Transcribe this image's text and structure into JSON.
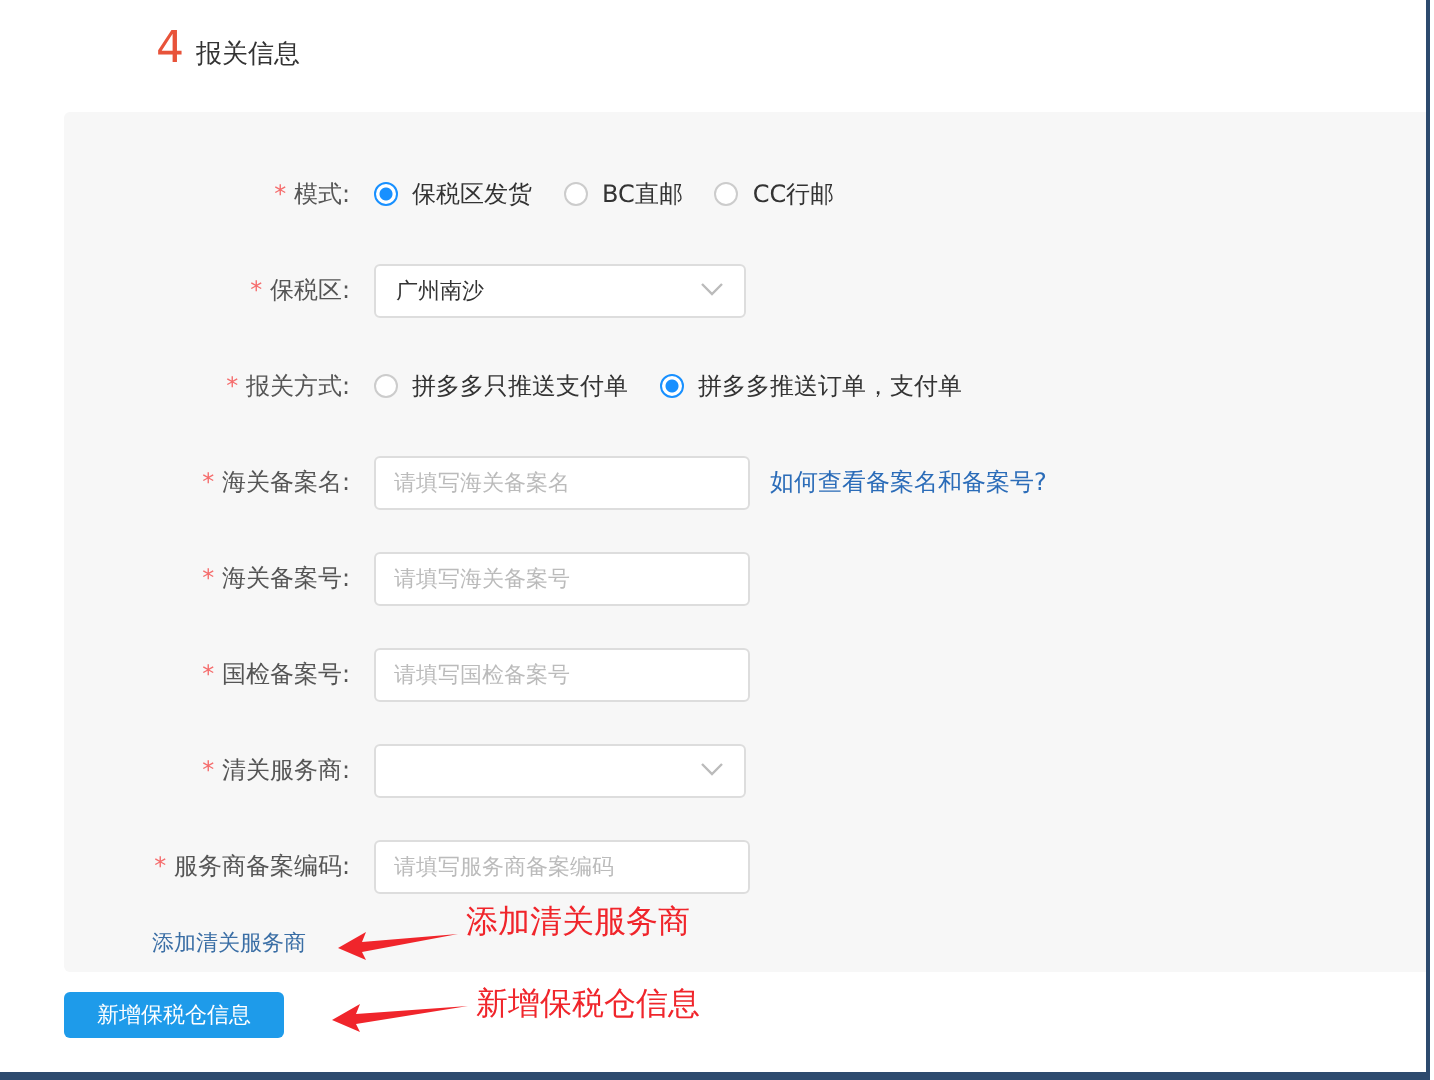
{
  "section": {
    "number": "4",
    "title": "报关信息"
  },
  "rows": [
    {
      "kind": "radio",
      "required_mark": "*",
      "label": "模式:",
      "options": [
        {
          "label": "保税区发货",
          "selected": true
        },
        {
          "label": "BC直邮",
          "selected": false
        },
        {
          "label": "CC行邮",
          "selected": false
        }
      ]
    },
    {
      "kind": "select",
      "required_mark": "*",
      "label": "保税区:",
      "value": "广州南沙"
    },
    {
      "kind": "radio",
      "required_mark": "*",
      "label": "报关方式:",
      "options": [
        {
          "label": "拼多多只推送支付单",
          "selected": false
        },
        {
          "label": "拼多多推送订单，支付单",
          "selected": true
        }
      ]
    },
    {
      "kind": "input",
      "required_mark": "*",
      "label": "海关备案名:",
      "placeholder": "请填写海关备案名",
      "link": "如何查看备案名和备案号?"
    },
    {
      "kind": "input",
      "required_mark": "*",
      "label": "海关备案号:",
      "placeholder": "请填写海关备案号"
    },
    {
      "kind": "input",
      "required_mark": "*",
      "label": "国检备案号:",
      "placeholder": "请填写国检备案号"
    },
    {
      "kind": "select",
      "required_mark": "*",
      "label": "清关服务商:"
    },
    {
      "kind": "input",
      "required_mark": "*",
      "label": "服务商备案编码:",
      "placeholder": "请填写服务商备案编码"
    }
  ],
  "add_link": "添加清关服务商",
  "add_button": "新增保税仓信息",
  "annotations": [
    "添加清关服务商",
    "新增保税仓信息"
  ]
}
